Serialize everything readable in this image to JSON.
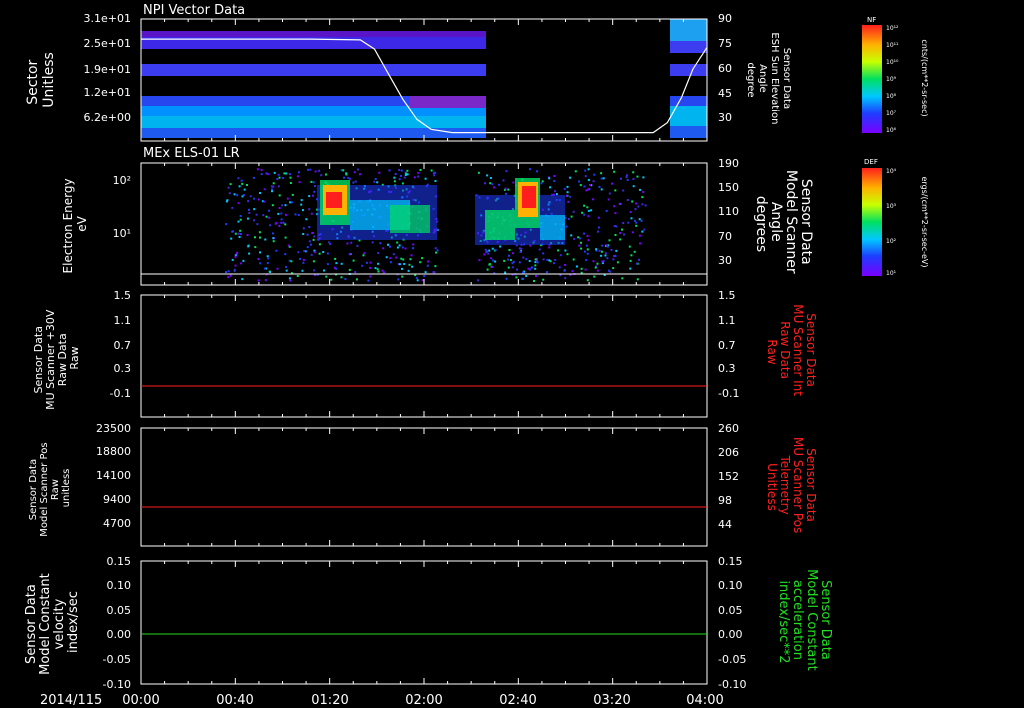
{
  "page": {
    "date_label": "2014/115",
    "x_ticks": [
      "00:00",
      "00:40",
      "01:20",
      "02:00",
      "02:40",
      "03:20",
      "04:00"
    ],
    "x_range_hours": [
      0,
      4
    ]
  },
  "panels": [
    {
      "id": "npi",
      "title": "NPI Vector Data",
      "left_label_lines": [
        "Sector",
        "Unitless"
      ],
      "right_label_lines": [
        "Sensor Data",
        "ESH Sun Elevation",
        "Angle",
        "degree"
      ],
      "right_label_color": "#ffffff",
      "left_ticks": [
        "3.1e+01",
        "2.5e+01",
        "1.9e+01",
        "1.2e+01",
        "6.2e+00"
      ],
      "right_ticks": [
        "90",
        "75",
        "60",
        "45",
        "30"
      ],
      "colorbar": {
        "code": "NF",
        "unit_label": "cnts/(cm**2-sr-sec)",
        "ticks": [
          "10¹²",
          "10¹¹",
          "10¹⁰",
          "10⁹",
          "10⁸",
          "10⁷",
          "10⁶"
        ]
      }
    },
    {
      "id": "els",
      "title": "MEx ELS-01 LR",
      "left_label_lines": [
        "Electron Energy",
        "eV"
      ],
      "right_label_lines": [
        "Sensor Data",
        "Model Scanner",
        "Angle",
        "degrees"
      ],
      "right_label_color": "#ffffff",
      "left_ticks": [
        "10²",
        "10¹"
      ],
      "right_ticks": [
        "190",
        "150",
        "110",
        "70",
        "30"
      ],
      "colorbar": {
        "code": "DEF",
        "unit_label": "ergs/(cm**2-sr-sec-eV)",
        "ticks": [
          "10⁴",
          "10³",
          "10²",
          "10¹"
        ]
      }
    },
    {
      "id": "raw30",
      "title": "",
      "left_label_lines": [
        "Sensor Data",
        "MU Scanner +30V",
        "Raw Data",
        "Raw"
      ],
      "right_label_lines": [
        "Sensor Data",
        "MU Scanner Int",
        "Raw Data",
        "Raw"
      ],
      "right_label_color": "#ff2020",
      "left_ticks": [
        "1.5",
        "1.1",
        "0.7",
        "0.3",
        "-0.1"
      ],
      "right_ticks": [
        "1.5",
        "1.1",
        "0.7",
        "0.3",
        "-0.1"
      ]
    },
    {
      "id": "pos",
      "title": "",
      "left_label_lines": [
        "Sensor Data",
        "Model Scanner Pos",
        "Raw",
        "unitless"
      ],
      "right_label_lines": [
        "Sensor Data",
        "MU Scanner Pos",
        "Telemetry",
        "Unitless"
      ],
      "right_label_color": "#ff2020",
      "left_ticks": [
        "23500",
        "18800",
        "14100",
        "9400",
        "4700"
      ],
      "right_ticks": [
        "260",
        "206",
        "152",
        "98",
        "44"
      ]
    },
    {
      "id": "vel",
      "title": "",
      "left_label_lines": [
        "Sensor Data",
        "Model Constant",
        "velocity",
        "index/sec"
      ],
      "right_label_lines": [
        "Sensor Data",
        "Model Constant",
        "acceleration",
        "index/sec**2"
      ],
      "right_label_color": "#20e020",
      "left_ticks": [
        "0.15",
        "0.10",
        "0.05",
        "0.00",
        "-0.05",
        "-0.10"
      ],
      "right_ticks": [
        "0.15",
        "0.10",
        "0.05",
        "0.00",
        "-0.05",
        "-0.10"
      ]
    }
  ],
  "chart_data": [
    {
      "type": "heatmap",
      "title": "NPI Vector Data",
      "ylabel": "Sector Unitless",
      "y2label": "Sensor Data ESH Sun Elevation Angle degree",
      "x_range_hours": [
        0,
        4
      ],
      "y_ticks": [
        "3.1e+01",
        "2.5e+01",
        "1.9e+01",
        "1.2e+01",
        "6.2e+00"
      ],
      "y2_range": [
        17,
        90
      ],
      "data_gap_hours": [
        2.6,
        3.75
      ],
      "band_color": "blue-purple (~10⁸–10⁹)",
      "series": [
        {
          "name": "",
          "color": "#ffffff",
          "x": [
            0.0,
            0.4,
            0.8,
            1.2,
            1.55,
            1.65,
            1.75,
            1.85,
            1.95,
            2.05,
            2.2,
            2.6,
            3.2,
            3.62,
            3.72,
            3.82,
            3.9,
            4.0
          ],
          "y": [
            78.0,
            78.0,
            78.0,
            78.0,
            77.5,
            72.0,
            57.0,
            42.0,
            30.0,
            24.0,
            22.0,
            22.0,
            22.0,
            22.0,
            28.0,
            43.0,
            60.0,
            73.0
          ]
        }
      ]
    },
    {
      "type": "heatmap",
      "title": "MEx ELS-01 LR",
      "ylabel": "Electron Energy eV",
      "y2label": "Sensor Data Model Scanner Angle degrees",
      "x_range_hours": [
        0,
        4
      ],
      "ylim": [
        1,
        200
      ],
      "yscale": "log",
      "y_ticks": [
        10,
        100
      ],
      "y2_range": [
        10,
        190
      ],
      "hot_spots": [
        {
          "x_hours": [
            1.1,
            1.3
          ],
          "energy_eV": [
            30,
            120
          ],
          "level": "10⁴"
        },
        {
          "x_hours": [
            2.65,
            2.8
          ],
          "energy_eV": [
            30,
            150
          ],
          "level": "10⁴"
        }
      ],
      "data_gap_hours": [
        2.25,
        2.35
      ],
      "series": [
        {
          "name": "",
          "color": "#ffffff",
          "x": [
            0,
            4
          ],
          "y": [
            22,
            22
          ]
        }
      ]
    },
    {
      "type": "line",
      "title": "",
      "ylabel": "Sensor Data MU Scanner +30V Raw Data Raw",
      "y2label": "Sensor Data MU Scanner Int Raw Data Raw",
      "x_range_hours": [
        0,
        4
      ],
      "ylim": [
        -0.3,
        1.5
      ],
      "series": [
        {
          "name": "",
          "color": "#ff2020",
          "x": [
            0,
            4
          ],
          "y": [
            0,
            0
          ]
        }
      ]
    },
    {
      "type": "line",
      "title": "",
      "ylabel": "Sensor Data Model Scanner Pos Raw unitless",
      "y2label": "Sensor Data MU Scanner Pos Telemetry Unitless",
      "x_range_hours": [
        0,
        4
      ],
      "ylim": [
        0,
        23500
      ],
      "y2_range": [
        0,
        260
      ],
      "series": [
        {
          "name": "",
          "color": "#ff2020",
          "x": [
            0,
            4
          ],
          "y": [
            8000,
            8000
          ]
        }
      ]
    },
    {
      "type": "line",
      "title": "",
      "ylabel": "Sensor Data Model Constant velocity index/sec",
      "y2label": "Sensor Data Model Constant acceleration index/sec**2",
      "x_range_hours": [
        0,
        4
      ],
      "ylim": [
        -0.1,
        0.15
      ],
      "series": [
        {
          "name": "",
          "color": "#20e020",
          "x": [
            0,
            4
          ],
          "y": [
            0,
            0
          ]
        }
      ]
    }
  ]
}
